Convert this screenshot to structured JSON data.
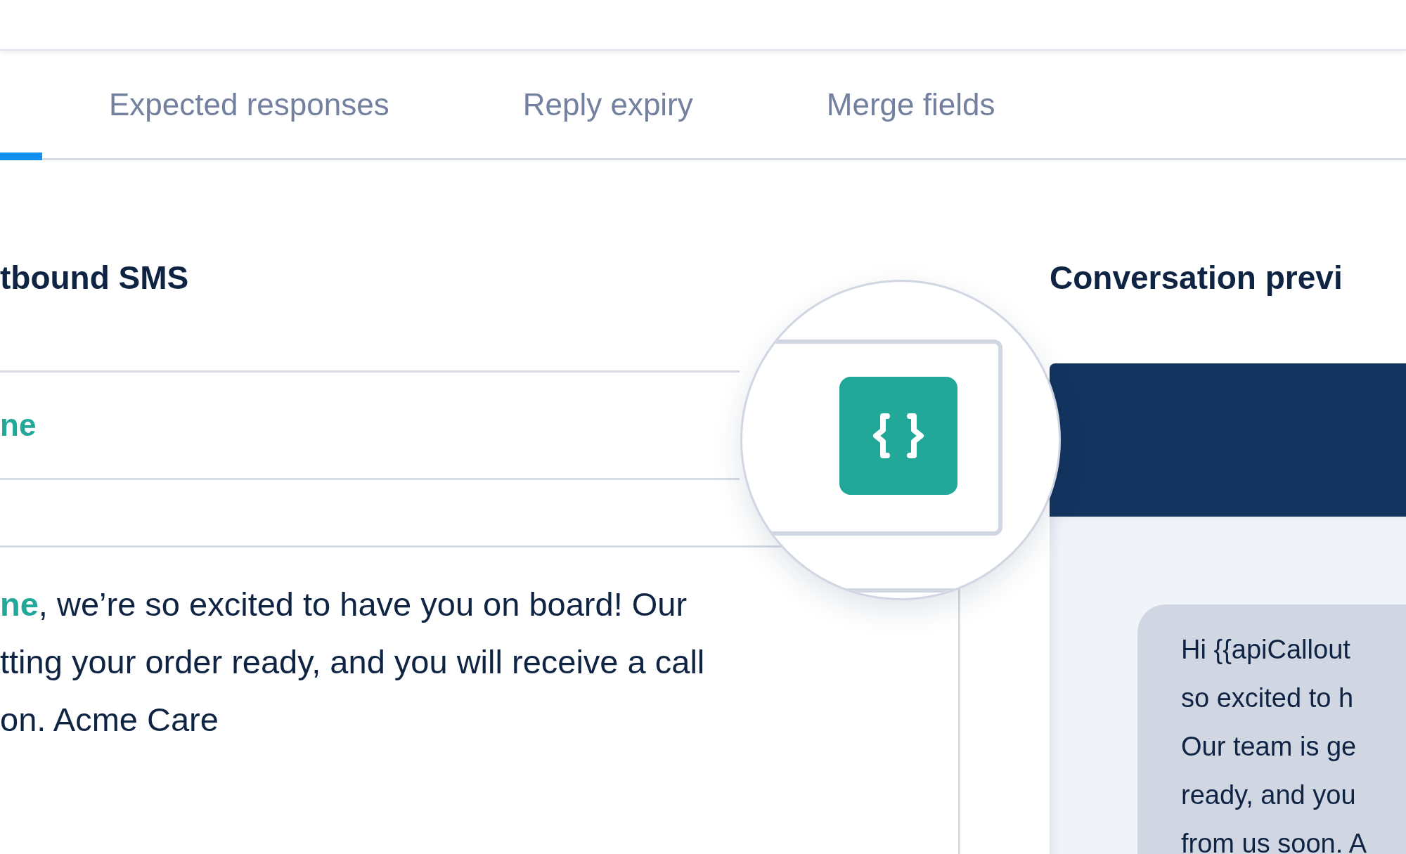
{
  "tabs": [
    {
      "selected": true
    },
    {
      "label": "Expected responses",
      "selected": false
    },
    {
      "label": "Reply expiry",
      "selected": false
    },
    {
      "label": "Merge fields",
      "selected": false
    }
  ],
  "editor": {
    "heading": "tbound SMS",
    "field_value": "ne",
    "message_lines": [
      "**ne**, we’re so excited to have you on board! Our",
      "tting your order ready, and you will receive a call",
      "on. Acme Care"
    ]
  },
  "preview": {
    "heading": "Conversation previ",
    "bubble_lines": [
      "Hi {{apiCallout",
      "so excited to h",
      "Our team is ge",
      "ready, and you",
      "from us soon. A"
    ]
  }
}
